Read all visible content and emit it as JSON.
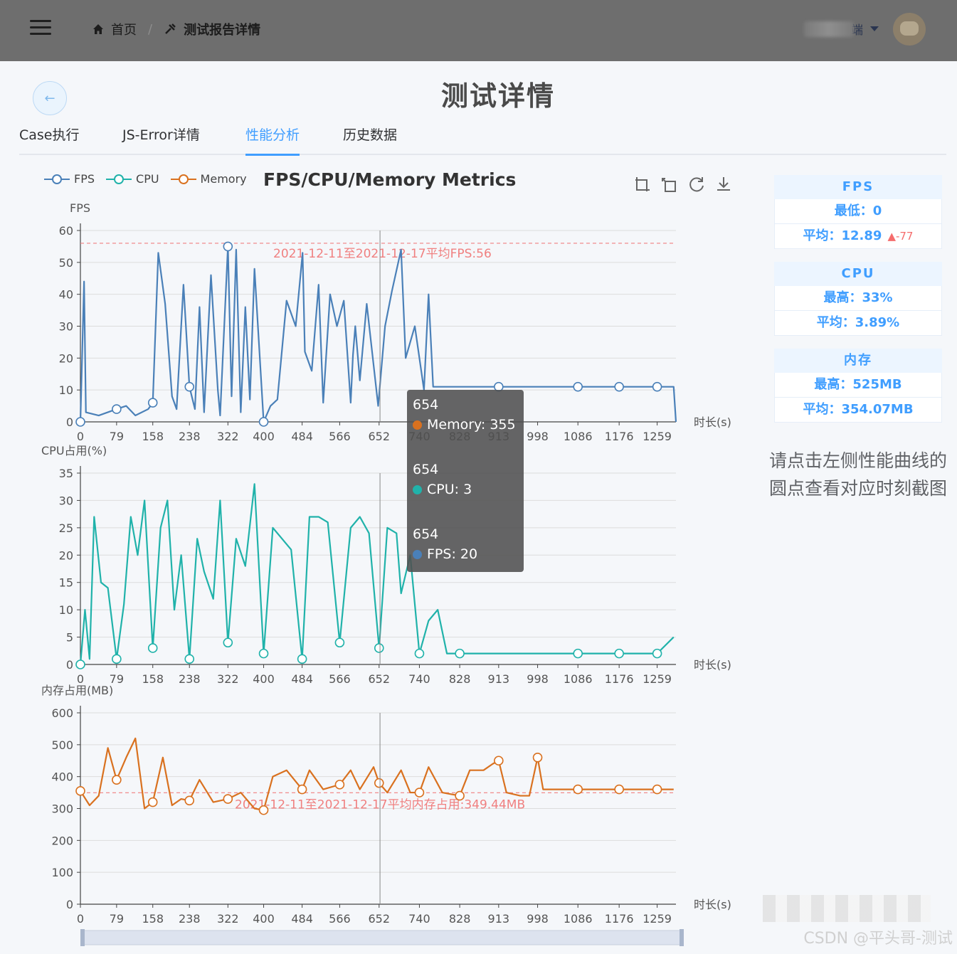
{
  "header": {
    "breadcrumb_home": "首页",
    "breadcrumb_current": "测试报告详情",
    "user_label": "端"
  },
  "page": {
    "title": "测试详情",
    "tabs": [
      "Case执行",
      "JS-Error详情",
      "性能分析",
      "历史数据"
    ],
    "active_tab": "性能分析"
  },
  "chart_legend": [
    "FPS",
    "CPU",
    "Memory"
  ],
  "chart_data": [
    {
      "type": "line",
      "title": "FPS/CPU/Memory Metrics",
      "series": [
        {
          "name": "FPS",
          "color": "#4a80b8",
          "values": [
            [
              0,
              0
            ],
            [
              8,
              44
            ],
            [
              12,
              3
            ],
            [
              40,
              2
            ],
            [
              79,
              4
            ],
            [
              100,
              5
            ],
            [
              120,
              2
            ],
            [
              148,
              4
            ],
            [
              158,
              6
            ],
            [
              170,
              53
            ],
            [
              185,
              37
            ],
            [
              200,
              8
            ],
            [
              210,
              4
            ],
            [
              225,
              43
            ],
            [
              238,
              11
            ],
            [
              250,
              4
            ],
            [
              260,
              36
            ],
            [
              270,
              3
            ],
            [
              285,
              46
            ],
            [
              300,
              10
            ],
            [
              305,
              2
            ],
            [
              322,
              55
            ],
            [
              330,
              8
            ],
            [
              340,
              54
            ],
            [
              350,
              3
            ],
            [
              360,
              36
            ],
            [
              370,
              7
            ],
            [
              380,
              48
            ],
            [
              400,
              0
            ],
            [
              415,
              5
            ],
            [
              430,
              7
            ],
            [
              450,
              38
            ],
            [
              470,
              30
            ],
            [
              485,
              53
            ],
            [
              490,
              22
            ],
            [
              505,
              16
            ],
            [
              520,
              43
            ],
            [
              530,
              6
            ],
            [
              545,
              40
            ],
            [
              560,
              30
            ],
            [
              575,
              38
            ],
            [
              590,
              6
            ],
            [
              595,
              21
            ],
            [
              600,
              30
            ],
            [
              610,
              13
            ],
            [
              625,
              37
            ],
            [
              650,
              5
            ],
            [
              665,
              30
            ],
            [
              680,
              41
            ],
            [
              700,
              54
            ],
            [
              710,
              20
            ],
            [
              730,
              30
            ],
            [
              750,
              10
            ],
            [
              760,
              40
            ],
            [
              770,
              11
            ],
            [
              800,
              11
            ],
            [
              860,
              11
            ],
            [
              913,
              11
            ],
            [
              1000,
              11
            ],
            [
              1086,
              11
            ],
            [
              1176,
              11
            ],
            [
              1259,
              11
            ],
            [
              1295,
              11
            ],
            [
              1300,
              0
            ]
          ]
        }
      ],
      "xlabel": "时长(s)",
      "ylabel": "FPS",
      "ylim": [
        0,
        60
      ],
      "x_ticks": [
        "0",
        "79",
        "158",
        "238",
        "322",
        "400",
        "484",
        "566",
        "652",
        "740",
        "828",
        "913",
        "998",
        "1086",
        "1176",
        "1259"
      ],
      "y_ticks": [
        "0",
        "10",
        "20",
        "30",
        "40",
        "50",
        "60"
      ],
      "markline_label": "2021-12-11至2021-12-17平均FPS:56",
      "markline_value": 56
    },
    {
      "type": "line",
      "series": [
        {
          "name": "CPU",
          "color": "#20b2aa",
          "values": [
            [
              0,
              0
            ],
            [
              10,
              10
            ],
            [
              20,
              1
            ],
            [
              30,
              27
            ],
            [
              45,
              15
            ],
            [
              60,
              14
            ],
            [
              79,
              1
            ],
            [
              95,
              11
            ],
            [
              110,
              27
            ],
            [
              125,
              20
            ],
            [
              140,
              30
            ],
            [
              158,
              3
            ],
            [
              175,
              25
            ],
            [
              190,
              30
            ],
            [
              205,
              10
            ],
            [
              220,
              20
            ],
            [
              238,
              1
            ],
            [
              255,
              23
            ],
            [
              270,
              17
            ],
            [
              290,
              12
            ],
            [
              305,
              30
            ],
            [
              322,
              4
            ],
            [
              340,
              23
            ],
            [
              360,
              18
            ],
            [
              380,
              33
            ],
            [
              400,
              2
            ],
            [
              420,
              25
            ],
            [
              440,
              23
            ],
            [
              460,
              21
            ],
            [
              484,
              1
            ],
            [
              500,
              27
            ],
            [
              520,
              27
            ],
            [
              540,
              26
            ],
            [
              566,
              4
            ],
            [
              590,
              25
            ],
            [
              610,
              27
            ],
            [
              630,
              24
            ],
            [
              652,
              3
            ],
            [
              670,
              25
            ],
            [
              690,
              24
            ],
            [
              700,
              13
            ],
            [
              720,
              20
            ],
            [
              740,
              2
            ],
            [
              760,
              8
            ],
            [
              780,
              10
            ],
            [
              800,
              2
            ],
            [
              828,
              2
            ],
            [
              900,
              2
            ],
            [
              1000,
              2
            ],
            [
              1086,
              2
            ],
            [
              1176,
              2
            ],
            [
              1259,
              2
            ],
            [
              1295,
              5
            ]
          ]
        }
      ],
      "xlabel": "时长(s)",
      "ylabel": "CPU占用(%)",
      "ylim": [
        0,
        35
      ],
      "x_ticks": [
        "0",
        "79",
        "158",
        "238",
        "322",
        "400",
        "484",
        "566",
        "652",
        "740",
        "828",
        "913",
        "998",
        "1086",
        "1176",
        "1259"
      ],
      "y_ticks": [
        "0",
        "5",
        "10",
        "15",
        "20",
        "25",
        "30",
        "35"
      ]
    },
    {
      "type": "line",
      "series": [
        {
          "name": "Memory",
          "color": "#d9711f",
          "values": [
            [
              0,
              355
            ],
            [
              20,
              310
            ],
            [
              40,
              340
            ],
            [
              60,
              490
            ],
            [
              79,
              390
            ],
            [
              100,
              460
            ],
            [
              120,
              520
            ],
            [
              140,
              300
            ],
            [
              158,
              320
            ],
            [
              180,
              460
            ],
            [
              200,
              310
            ],
            [
              220,
              330
            ],
            [
              238,
              325
            ],
            [
              260,
              390
            ],
            [
              290,
              320
            ],
            [
              322,
              330
            ],
            [
              350,
              350
            ],
            [
              380,
              300
            ],
            [
              400,
              295
            ],
            [
              420,
              400
            ],
            [
              450,
              420
            ],
            [
              484,
              360
            ],
            [
              500,
              420
            ],
            [
              530,
              360
            ],
            [
              566,
              375
            ],
            [
              590,
              420
            ],
            [
              610,
              360
            ],
            [
              640,
              430
            ],
            [
              652,
              380
            ],
            [
              670,
              350
            ],
            [
              700,
              420
            ],
            [
              720,
              350
            ],
            [
              740,
              350
            ],
            [
              760,
              430
            ],
            [
              790,
              350
            ],
            [
              828,
              340
            ],
            [
              850,
              420
            ],
            [
              880,
              420
            ],
            [
              900,
              440
            ],
            [
              913,
              450
            ],
            [
              930,
              350
            ],
            [
              960,
              340
            ],
            [
              980,
              340
            ],
            [
              998,
              460
            ],
            [
              1010,
              360
            ],
            [
              1086,
              360
            ],
            [
              1176,
              360
            ],
            [
              1259,
              360
            ],
            [
              1295,
              360
            ]
          ]
        }
      ],
      "xlabel": "时长(s)",
      "ylabel": "内存占用(MB)",
      "ylim": [
        0,
        600
      ],
      "x_ticks": [
        "0",
        "79",
        "158",
        "238",
        "322",
        "400",
        "484",
        "566",
        "652",
        "740",
        "828",
        "913",
        "998",
        "1086",
        "1176",
        "1259"
      ],
      "y_ticks": [
        "0",
        "100",
        "200",
        "300",
        "400",
        "500",
        "600"
      ],
      "markline_label": "2021-12-11至2021-12-17平均内存占用:349.44MB",
      "markline_value": 349.44
    }
  ],
  "tooltip": {
    "x": "654",
    "items": [
      {
        "x": "654",
        "label": "Memory: 355",
        "color": "#d9711f"
      },
      {
        "x": "654",
        "label": "CPU: 3",
        "color": "#20b2aa"
      },
      {
        "x": "654",
        "label": "FPS: 20",
        "color": "#4a80b8"
      }
    ]
  },
  "stats": {
    "fps": {
      "title": "FPS",
      "min": "最低：0",
      "avg": "平均：12.89",
      "delta": "▲-77"
    },
    "cpu": {
      "title": "CPU",
      "max": "最高：33%",
      "avg": "平均：3.89%"
    },
    "mem": {
      "title": "内存",
      "max": "最高：525MB",
      "avg": "平均：354.07MB"
    }
  },
  "hint": "请点击左侧性能曲线的圆点查看对应时刻截图",
  "watermark": "CSDN @平头哥-测试"
}
